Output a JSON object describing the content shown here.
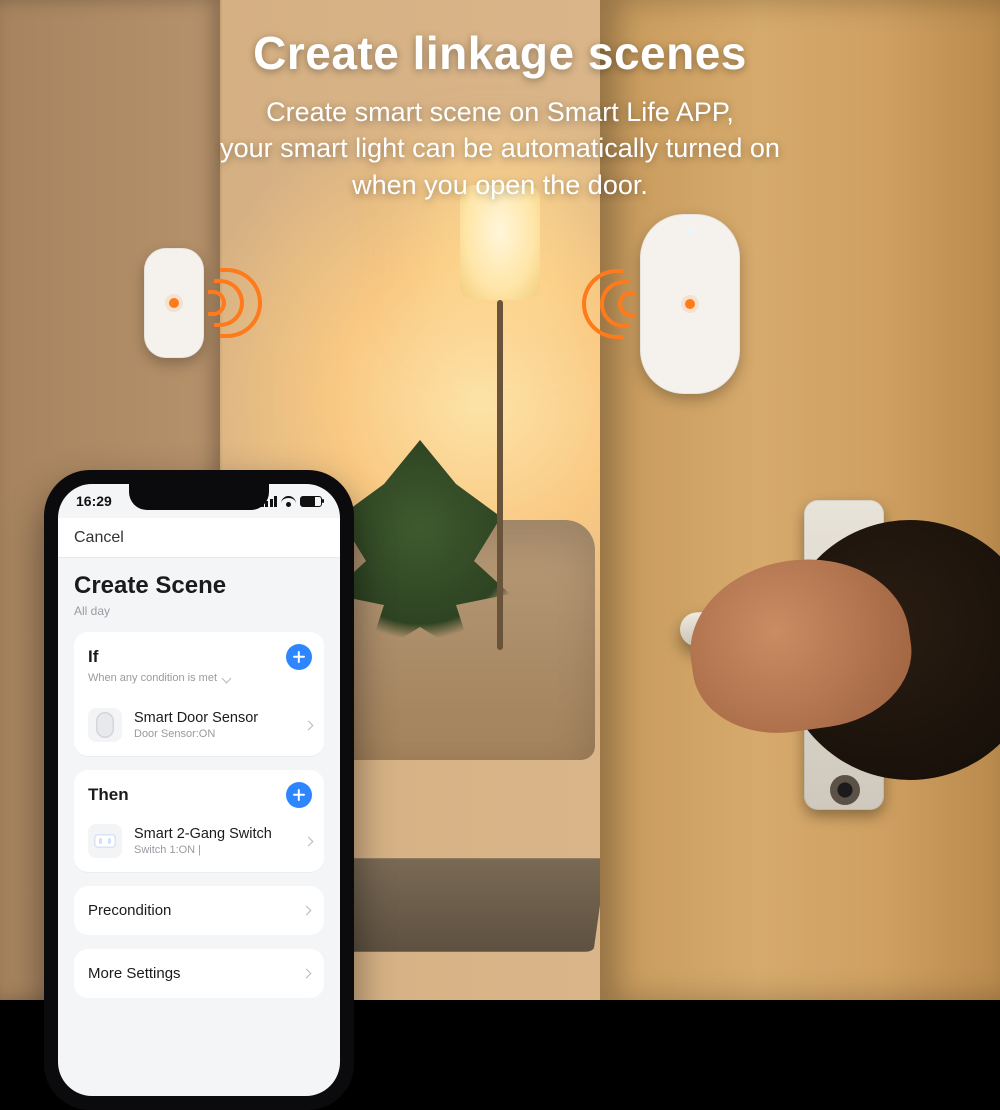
{
  "headline": {
    "title": "Create linkage scenes",
    "subtitle": "Create smart scene on Smart Life APP,\nyour smart light can be automatically turned on\nwhen you open the door."
  },
  "phone": {
    "status_time": "16:29",
    "nav_cancel": "Cancel",
    "page_title": "Create Scene",
    "page_subtitle": "All day",
    "if_section": {
      "title": "If",
      "hint": "When any condition is met",
      "device_name": "Smart Door Sensor",
      "device_state": "Door Sensor:ON"
    },
    "then_section": {
      "title": "Then",
      "device_name": "Smart 2-Gang Switch",
      "device_state": "Switch 1:ON  |"
    },
    "rows": {
      "precondition": "Precondition",
      "more_settings": "More Settings"
    }
  }
}
